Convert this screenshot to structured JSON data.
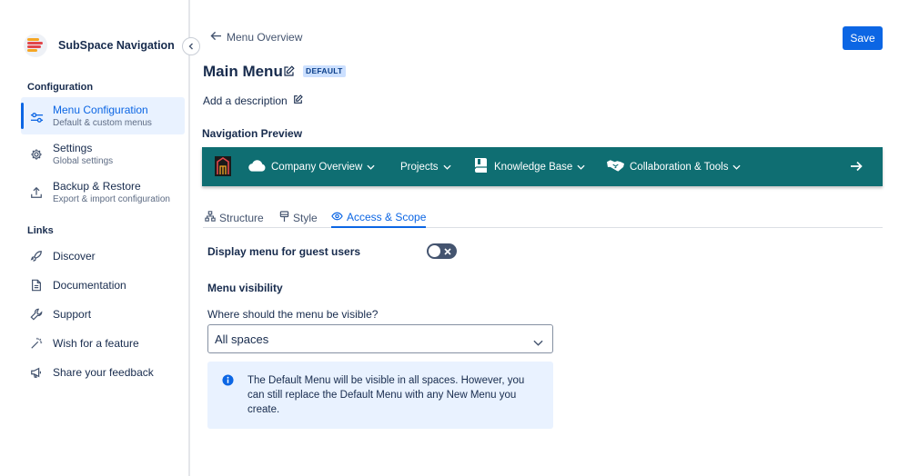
{
  "brand": {
    "name": "SubSpace Navigation"
  },
  "sidebar": {
    "config_section": "Configuration",
    "config_items": [
      {
        "title": "Menu Configuration",
        "subtitle": "Default & custom menus",
        "icon": "sliders-icon",
        "active": true
      },
      {
        "title": "Settings",
        "subtitle": "Global settings",
        "icon": "gear-icon",
        "active": false
      },
      {
        "title": "Backup & Restore",
        "subtitle": "Export & import configuration",
        "icon": "upload-icon",
        "active": false
      }
    ],
    "links_section": "Links",
    "links": [
      {
        "title": "Discover",
        "icon": "rocket-icon"
      },
      {
        "title": "Documentation",
        "icon": "document-icon"
      },
      {
        "title": "Support",
        "icon": "wrench-icon"
      },
      {
        "title": "Wish for a feature",
        "icon": "magic-wand-icon"
      },
      {
        "title": "Share your feedback",
        "icon": "megaphone-icon"
      }
    ]
  },
  "header": {
    "back_label": "Menu Overview",
    "save_label": "Save",
    "title": "Main Menu",
    "badge": "DEFAULT",
    "add_description": "Add a description"
  },
  "preview": {
    "label": "Navigation Preview",
    "bar_color": "#0f6e72",
    "items": [
      {
        "label": "Company Overview",
        "icon": "cloud-icon"
      },
      {
        "label": "Projects",
        "icon": ""
      },
      {
        "label": "Knowledge Base",
        "icon": "book-icon"
      },
      {
        "label": "Collaboration & Tools",
        "icon": "handshake-icon"
      }
    ]
  },
  "tabs": [
    {
      "label": "Structure",
      "icon": "hierarchy-icon",
      "active": false
    },
    {
      "label": "Style",
      "icon": "paintbrush-icon",
      "active": false
    },
    {
      "label": "Access & Scope",
      "icon": "eye-icon",
      "active": true
    }
  ],
  "access": {
    "guest_label": "Display menu for guest users",
    "guest_enabled": false,
    "visibility_heading": "Menu visibility",
    "where_label": "Where should the menu be visible?",
    "selected_scope": "All spaces",
    "info_message": "The Default Menu will be visible in all spaces. However, you can still replace the Default Menu with any New Menu you create."
  },
  "colors": {
    "accent": "#0c66e4",
    "badge_bg": "#cce0ff",
    "info_bg": "#e9f2ff"
  }
}
